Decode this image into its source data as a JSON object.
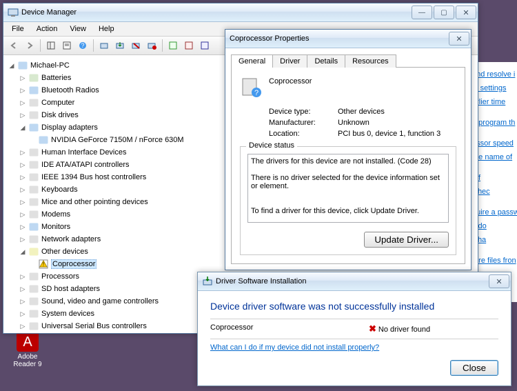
{
  "devmgr": {
    "title": "Device Manager",
    "menus": [
      "File",
      "Action",
      "View",
      "Help"
    ],
    "root": "Michael-PC",
    "categories": [
      {
        "label": "Batteries",
        "icon": "battery"
      },
      {
        "label": "Bluetooth Radios",
        "icon": "bluetooth"
      },
      {
        "label": "Computer",
        "icon": "computer"
      },
      {
        "label": "Disk drives",
        "icon": "disk"
      },
      {
        "label": "Display adapters",
        "icon": "display",
        "expanded": true,
        "children": [
          {
            "label": "NVIDIA GeForce 7150M / nForce 630M",
            "icon": "display"
          }
        ]
      },
      {
        "label": "Human Interface Devices",
        "icon": "hid"
      },
      {
        "label": "IDE ATA/ATAPI controllers",
        "icon": "ide"
      },
      {
        "label": "IEEE 1394 Bus host controllers",
        "icon": "ieee"
      },
      {
        "label": "Keyboards",
        "icon": "keyboard"
      },
      {
        "label": "Mice and other pointing devices",
        "icon": "mouse"
      },
      {
        "label": "Modems",
        "icon": "modem"
      },
      {
        "label": "Monitors",
        "icon": "monitor"
      },
      {
        "label": "Network adapters",
        "icon": "network"
      },
      {
        "label": "Other devices",
        "icon": "other",
        "expanded": true,
        "children": [
          {
            "label": "Coprocessor",
            "icon": "warn",
            "selected": true
          }
        ]
      },
      {
        "label": "Processors",
        "icon": "cpu"
      },
      {
        "label": "SD host adapters",
        "icon": "sd"
      },
      {
        "label": "Sound, video and game controllers",
        "icon": "sound"
      },
      {
        "label": "System devices",
        "icon": "system"
      },
      {
        "label": "Universal Serial Bus controllers",
        "icon": "usb"
      }
    ]
  },
  "props": {
    "title": "Coprocessor Properties",
    "tabs": [
      "General",
      "Driver",
      "Details",
      "Resources"
    ],
    "device_name": "Coprocessor",
    "rows": {
      "type_label": "Device type:",
      "type_value": "Other devices",
      "mfr_label": "Manufacturer:",
      "mfr_value": "Unknown",
      "loc_label": "Location:",
      "loc_value": "PCI bus 0, device 1, function 3"
    },
    "status_legend": "Device status",
    "status_text": "The drivers for this device are not installed. (Code 28)\n\nThere is no driver selected for the device information set or element.\n\n\nTo find a driver for this device, click Update Driver.",
    "update_btn": "Update Driver..."
  },
  "notif": {
    "title": "Driver Software Installation",
    "heading": "Device driver software was not successfully installed",
    "device": "Coprocessor",
    "result": "No driver found",
    "help_link": "What can I do if my device did not install properly?",
    "close_btn": "Close"
  },
  "bg_links": [
    "and resolve i",
    "ol settings",
    "arlier time",
    "a program th",
    "essor speed",
    "the name of",
    "off",
    "Chec",
    "quire a passw",
    "s do",
    "Cha",
    "tore files fron"
  ],
  "desktop": {
    "adobe": "Adobe\nReader 9"
  }
}
